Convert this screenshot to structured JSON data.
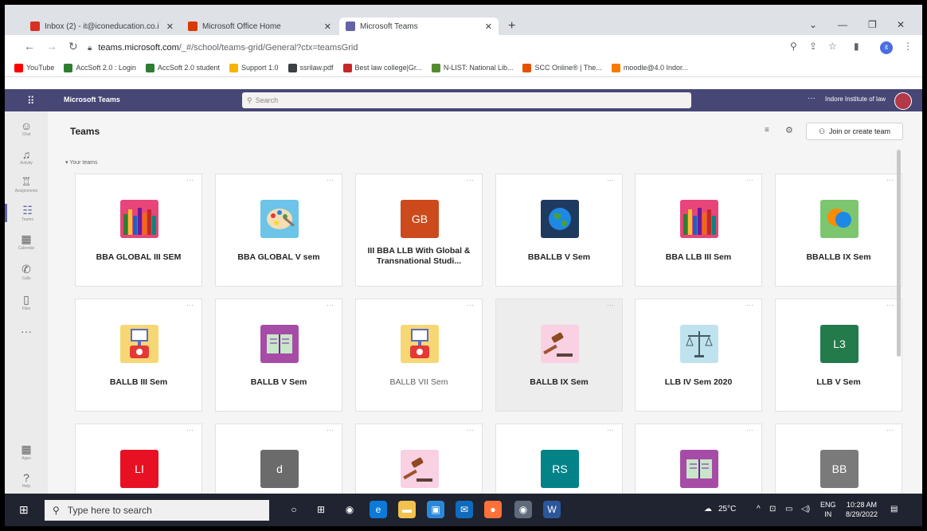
{
  "browser": {
    "tabs": [
      {
        "label": "Inbox (2) - it@iconeducation.co.i",
        "icon_color": "#d93025",
        "icon": "gmail-icon"
      },
      {
        "label": "Microsoft Office Home",
        "icon_color": "#d83b01",
        "icon": "office-icon"
      },
      {
        "label": "Microsoft Teams",
        "icon_color": "#6264a7",
        "icon": "teams-icon"
      }
    ],
    "url_host": "teams.microsoft.com",
    "url_path": "/_#/school/teams-grid/General?ctx=teamsGrid",
    "profile_initial": "it",
    "bookmarks": [
      {
        "label": "YouTube",
        "color": "#ff0000"
      },
      {
        "label": "AccSoft 2.0 : Login",
        "color": "#2e7d32"
      },
      {
        "label": "AccSoft 2.0 student",
        "color": "#2e7d32"
      },
      {
        "label": "Support 1.0",
        "color": "#f4b400"
      },
      {
        "label": "ssrilaw.pdf",
        "color": "#3c4043"
      },
      {
        "label": "Best law college|Gr...",
        "color": "#c62828"
      },
      {
        "label": "N-LIST: National Lib...",
        "color": "#558b2f"
      },
      {
        "label": "SCC Online® | The...",
        "color": "#e65100"
      },
      {
        "label": "moodle@4.0 Indor...",
        "color": "#f57c00"
      }
    ]
  },
  "teams": {
    "brand": "Microsoft Teams",
    "search_placeholder": "Search",
    "org_name": "Indore Institute of law",
    "page_title": "Teams",
    "join_label": "Join or create team",
    "section_label": "Your teams",
    "app_bar": [
      {
        "label": "Chat",
        "icon": "chat-icon",
        "glyph": "☺"
      },
      {
        "label": "Activity",
        "icon": "bell-icon",
        "glyph": "♫"
      },
      {
        "label": "Assignments",
        "icon": "assignments-icon",
        "glyph": "♖"
      },
      {
        "label": "Teams",
        "icon": "teams-icon",
        "glyph": "☷"
      },
      {
        "label": "Calendar",
        "icon": "calendar-icon",
        "glyph": "▦"
      },
      {
        "label": "Calls",
        "icon": "phone-icon",
        "glyph": "✆"
      },
      {
        "label": "Files",
        "icon": "files-icon",
        "glyph": "▯"
      },
      {
        "label": "",
        "icon": "more-icon",
        "glyph": "···"
      }
    ],
    "app_bar_bottom": [
      {
        "label": "Apps",
        "icon": "apps-icon",
        "glyph": "▦"
      },
      {
        "label": "Help",
        "icon": "help-icon",
        "glyph": "?"
      }
    ],
    "cards": [
      {
        "name": "BBA GLOBAL III SEM",
        "tile": "pencils",
        "color": "#e8457a",
        "text": ""
      },
      {
        "name": "BBA GLOBAL V sem",
        "tile": "palette",
        "color": "#6cc4e8",
        "text": ""
      },
      {
        "name": "III BBA LLB With Global & Transnational Studi...",
        "tile": "initials",
        "color": "#cc4a1c",
        "text": "GB"
      },
      {
        "name": "BBALLB V Sem",
        "tile": "globe",
        "color": "#1f3a5f",
        "text": ""
      },
      {
        "name": "BBA LLB III Sem",
        "tile": "pencils",
        "color": "#e8457a",
        "text": ""
      },
      {
        "name": "BBALLB IX Sem",
        "tile": "chat",
        "color": "#7cc66e",
        "text": ""
      },
      {
        "name": "BALLB III Sem",
        "tile": "presenter",
        "color": "#f7d774",
        "text": ""
      },
      {
        "name": "BALLB V Sem",
        "tile": "book",
        "color": "#a64ca6",
        "text": ""
      },
      {
        "name": "BALLB VII Sem",
        "tile": "presenter",
        "color": "#f7d774",
        "text": "",
        "light": true
      },
      {
        "name": "BALLB IX Sem",
        "tile": "gavel",
        "color": "#f9d1e3",
        "text": "",
        "highlighted": true
      },
      {
        "name": "LLB IV Sem 2020",
        "tile": "scales",
        "color": "#bfe3ee",
        "text": ""
      },
      {
        "name": "LLB V Sem",
        "tile": "initials",
        "color": "#237b4b",
        "text": "L3"
      },
      {
        "name": "",
        "tile": "initials",
        "color": "#e81123",
        "text": "LI"
      },
      {
        "name": "",
        "tile": "initials",
        "color": "#6b6b6b",
        "text": "d"
      },
      {
        "name": "",
        "tile": "gavel",
        "color": "#f9d1e3",
        "text": ""
      },
      {
        "name": "",
        "tile": "initials",
        "color": "#038387",
        "text": "RS"
      },
      {
        "name": "",
        "tile": "book",
        "color": "#a64ca6",
        "text": ""
      },
      {
        "name": "",
        "tile": "initials",
        "color": "#7a7a7a",
        "text": "BB"
      }
    ]
  },
  "taskbar": {
    "search_placeholder": "Type here to search",
    "temperature": "25°C",
    "lang_top": "ENG",
    "lang_bottom": "IN",
    "time": "10:28 AM",
    "date": "8/29/2022",
    "apps": [
      {
        "icon": "cortana-icon",
        "color": "transparent",
        "glyph": "○"
      },
      {
        "icon": "task-view-icon",
        "color": "transparent",
        "glyph": "⊞"
      },
      {
        "icon": "chrome-icon",
        "color": "transparent",
        "glyph": "◉"
      },
      {
        "icon": "edge-icon",
        "color": "#0c7ad6",
        "glyph": "e"
      },
      {
        "icon": "file-explorer-icon",
        "color": "#f2c14e",
        "glyph": "▬"
      },
      {
        "icon": "store-icon",
        "color": "#2b88d8",
        "glyph": "▣"
      },
      {
        "icon": "mail-icon",
        "color": "#0f6cbd",
        "glyph": "✉"
      },
      {
        "icon": "firefox-icon",
        "color": "#ff7139",
        "glyph": "●"
      },
      {
        "icon": "chrome-active-icon",
        "color": "#5f6b7a",
        "glyph": "◉"
      },
      {
        "icon": "word-icon",
        "color": "#2b579a",
        "glyph": "W"
      }
    ]
  }
}
